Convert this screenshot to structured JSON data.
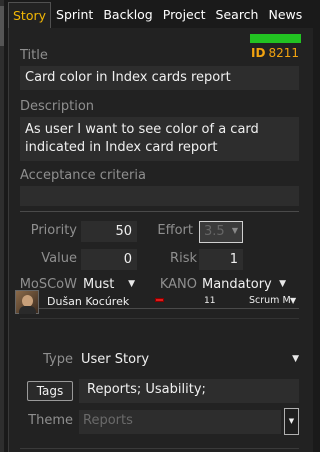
{
  "tabs": [
    {
      "label": "Story",
      "active": true
    },
    {
      "label": "Sprint"
    },
    {
      "label": "Backlog"
    },
    {
      "label": "Project"
    },
    {
      "label": "Search"
    },
    {
      "label": "News"
    }
  ],
  "story": {
    "id_label": "ID",
    "id_value": "8211",
    "title_label": "Title",
    "title_value": "Card color in Index cards report",
    "description_label": "Description",
    "description_value": "As user I want to see color of a card indicated in Index card report",
    "acceptance_label": "Acceptance criteria",
    "acceptance_value": ""
  },
  "metrics": {
    "priority_label": "Priority",
    "priority_value": "50",
    "effort_label": "Effort",
    "effort_value": "3.5",
    "value_label": "Value",
    "value_value": "0",
    "risk_label": "Risk",
    "risk_value": "1",
    "moscow_label": "MoSCoW",
    "moscow_value": "Must",
    "kano_label": "KANO",
    "kano_value": "Mandatory"
  },
  "owner": {
    "name": "Dušan Kocúrek",
    "count": "11",
    "team": "Scrum M"
  },
  "details": {
    "type_label": "Type",
    "type_value": "User Story",
    "tags_button": "Tags",
    "tags_value": "Reports; Usability;",
    "theme_label": "Theme",
    "theme_placeholder": "Reports"
  },
  "icons": {
    "caret": "caret-down-icon",
    "avatar": "user-avatar"
  },
  "colors": {
    "accent": "#f2b705",
    "status_bar": "#22c322",
    "priority_mark": "#e01b1b"
  }
}
